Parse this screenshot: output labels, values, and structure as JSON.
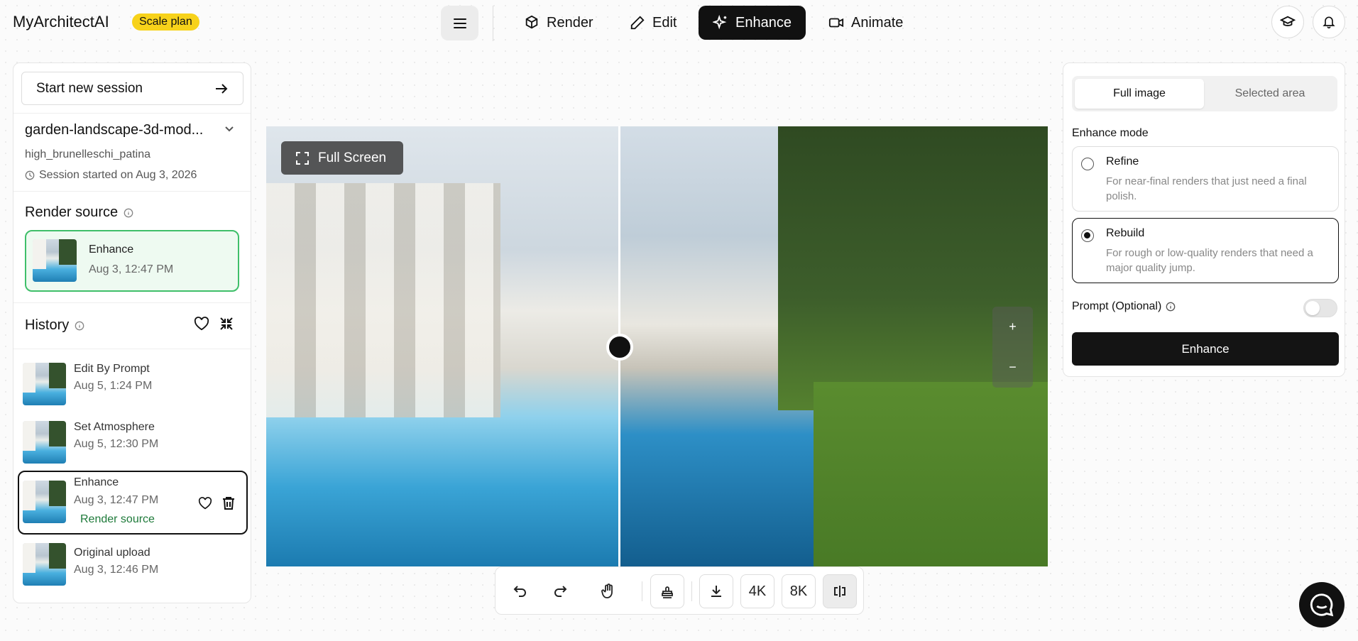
{
  "app": {
    "brand": "MyArchitectAI",
    "plan_badge": "Scale plan"
  },
  "nav": {
    "tabs": [
      {
        "label": "Render",
        "icon": "cube-icon"
      },
      {
        "label": "Edit",
        "icon": "pencil-icon"
      },
      {
        "label": "Enhance",
        "icon": "sparkles-icon",
        "active": true
      },
      {
        "label": "Animate",
        "icon": "video-icon"
      }
    ]
  },
  "sidebar": {
    "new_session": "Start new session",
    "project": {
      "title": "garden-landscape-3d-mod...",
      "style": "high_brunelleschi_patina",
      "session": "Session started on Aug 3, 2026"
    },
    "render_source": {
      "heading": "Render source",
      "card_label": "Enhance",
      "card_date": "Aug 3, 12:47 PM"
    },
    "history": {
      "heading": "History",
      "items": [
        {
          "title": "Edit By Prompt",
          "date": "Aug 5, 1:24 PM"
        },
        {
          "title": "Set Atmosphere",
          "date": "Aug 5, 12:30 PM"
        },
        {
          "title": "Enhance",
          "date": "Aug 3, 12:47 PM",
          "tag": "Render source",
          "selected": true
        },
        {
          "title": "Original upload",
          "date": "Aug 3, 12:46 PM"
        }
      ]
    }
  },
  "canvas": {
    "fullscreen_label": "Full Screen",
    "zoom_in": "+",
    "zoom_out": "−"
  },
  "toolbar": {
    "res_4k": "4K",
    "res_8k": "8K"
  },
  "panel": {
    "tabs": {
      "full": "Full image",
      "selected": "Selected area"
    },
    "mode_label": "Enhance mode",
    "modes": [
      {
        "title": "Refine",
        "desc": "For near-final renders that just need a final polish.",
        "selected": false
      },
      {
        "title": "Rebuild",
        "desc": "For rough or low-quality renders that need a major quality jump.",
        "selected": true
      }
    ],
    "prompt_label": "Prompt (Optional)",
    "prompt_enabled": false,
    "enhance_button": "Enhance"
  },
  "colors": {
    "accent_badge": "#f7d21a",
    "source_border": "#3fbf6a",
    "primary": "#141414"
  }
}
